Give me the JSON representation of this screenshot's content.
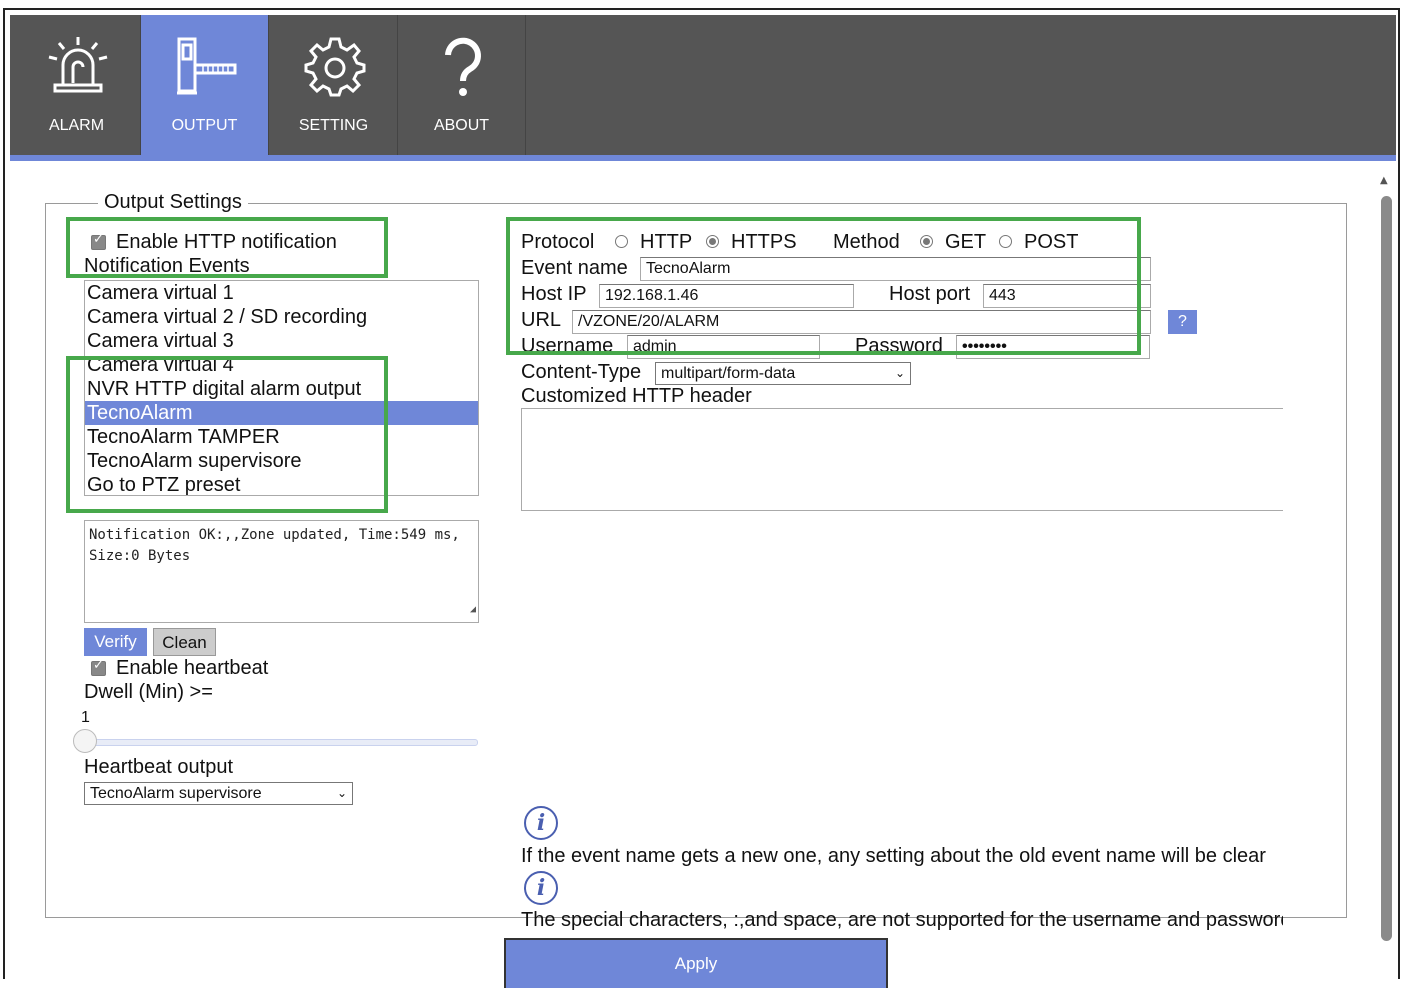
{
  "nav": {
    "tabs": [
      {
        "label": "ALARM",
        "icon": "siren-icon"
      },
      {
        "label": "OUTPUT",
        "icon": "barrier-gate-icon",
        "active": true
      },
      {
        "label": "SETTING",
        "icon": "gear-icon"
      },
      {
        "label": "ABOUT",
        "icon": "question-mark-icon"
      }
    ]
  },
  "output_settings": {
    "legend": "Output Settings",
    "enable_http_label": "Enable HTTP notification",
    "enable_http_checked": true,
    "notification_events_label": "Notification Events",
    "events": [
      "Camera virtual 1",
      "Camera virtual 2 / SD recording",
      "Camera virtual 3",
      "Camera virtual 4",
      "NVR HTTP digital alarm output",
      "TecnoAlarm",
      "TecnoAlarm TAMPER",
      "TecnoAlarm supervisore",
      "Go to PTZ preset"
    ],
    "selected_event": "TecnoAlarm",
    "result_text": "Notification OK:,,Zone updated, Time:549 ms, Size:0 Bytes",
    "verify_label": "Verify",
    "clean_label": "Clean",
    "enable_heartbeat_label": "Enable heartbeat",
    "enable_heartbeat_checked": true,
    "dwell_label": "Dwell (Min) >=",
    "dwell_value": "1",
    "heartbeat_output_label": "Heartbeat output",
    "heartbeat_output_value": "TecnoAlarm supervisore"
  },
  "http": {
    "protocol_label": "Protocol",
    "protocol_options": [
      "HTTP",
      "HTTPS"
    ],
    "protocol_selected": "HTTPS",
    "method_label": "Method",
    "method_options": [
      "GET",
      "POST"
    ],
    "method_selected": "GET",
    "event_name_label": "Event name",
    "event_name_value": "TecnoAlarm",
    "host_ip_label": "Host IP",
    "host_ip_value": "192.168.1.46",
    "host_port_label": "Host port",
    "host_port_value": "443",
    "url_label": "URL",
    "url_value": "/VZONE/20/ALARM",
    "help_label": "?",
    "username_label": "Username",
    "username_value": "admin",
    "password_label": "Password",
    "password_value": "••••••••",
    "content_type_label": "Content-Type",
    "content_type_value": "multipart/form-data",
    "custom_header_label": "Customized HTTP header",
    "custom_header_value": ""
  },
  "notes": {
    "note1": "If the event name gets a new one, any setting about the old event name will be clear",
    "note2": "The special characters, :,and space, are not supported for the username and password"
  },
  "apply_label": "Apply",
  "colors": {
    "accent": "#6f87d8",
    "topbar": "#555555",
    "highlight": "#47a84b"
  }
}
